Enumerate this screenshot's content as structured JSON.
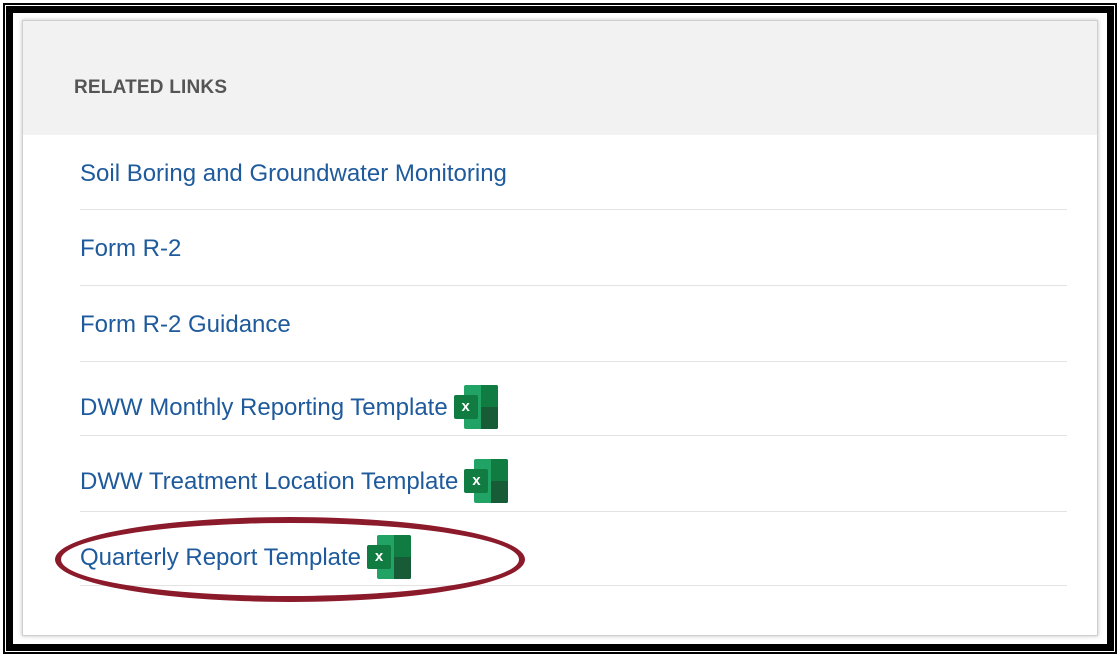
{
  "panel": {
    "title": "RELATED LINKS"
  },
  "links": [
    {
      "label": "Soil Boring and Groundwater Monitoring",
      "icon": null
    },
    {
      "label": "Form R-2",
      "icon": null
    },
    {
      "label": "Form R-2 Guidance",
      "icon": null
    },
    {
      "label": "DWW Monthly Reporting Template",
      "icon": "excel-file-icon"
    },
    {
      "label": "DWW Treatment Location Template",
      "icon": "excel-file-icon"
    },
    {
      "label": "Quarterly Report Template",
      "icon": "excel-file-icon"
    }
  ],
  "excel_icon": {
    "glyph": "x"
  },
  "highlight": {
    "target": "Quarterly Report Template",
    "color": "#8b1a2a"
  },
  "colors": {
    "link": "#1e5a9c",
    "header_bg": "#f2f2f2",
    "title_text": "#555555",
    "excel_green": "#107c41"
  }
}
